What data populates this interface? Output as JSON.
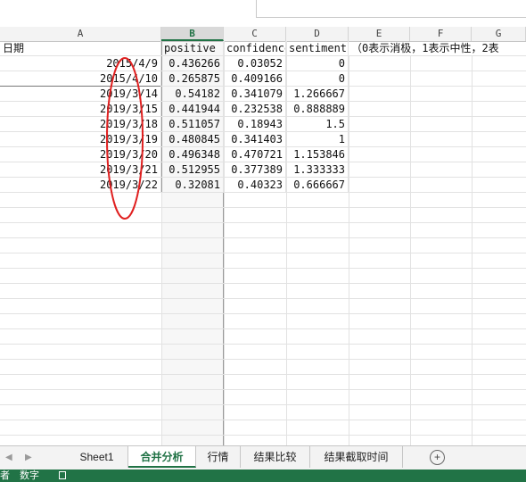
{
  "columns": [
    {
      "id": "A",
      "label": "A"
    },
    {
      "id": "B",
      "label": "B"
    },
    {
      "id": "C",
      "label": "C"
    },
    {
      "id": "D",
      "label": "D"
    },
    {
      "id": "E",
      "label": "E"
    },
    {
      "id": "F",
      "label": "F"
    },
    {
      "id": "G",
      "label": "G"
    }
  ],
  "selected_column": "B",
  "header_row": {
    "A": "日期",
    "B": "positive",
    "C": "confidence",
    "D": "sentiment",
    "E": "（0表示消极，1表示中性，2表"
  },
  "rows": [
    {
      "A": "2015/4/9",
      "B": "0.436266",
      "C": "0.03052",
      "D": "0"
    },
    {
      "A": "2015/4/10",
      "B": "0.265875",
      "C": "0.409166",
      "D": "0"
    },
    {
      "A": "2019/3/14",
      "B": "0.54182",
      "C": "0.341079",
      "D": "1.266667"
    },
    {
      "A": "2019/3/15",
      "B": "0.441944",
      "C": "0.232538",
      "D": "0.888889"
    },
    {
      "A": "2019/3/18",
      "B": "0.511057",
      "C": "0.18943",
      "D": "1.5"
    },
    {
      "A": "2019/3/19",
      "B": "0.480845",
      "C": "0.341403",
      "D": "1"
    },
    {
      "A": "2019/3/20",
      "B": "0.496348",
      "C": "0.470721",
      "D": "1.153846"
    },
    {
      "A": "2019/3/21",
      "B": "0.512955",
      "C": "0.377389",
      "D": "1.333333"
    },
    {
      "A": "2019/3/22",
      "B": "0.32081",
      "C": "0.40323",
      "D": "0.666667"
    }
  ],
  "tabs": [
    {
      "label": "Sheet1",
      "active": false
    },
    {
      "label": "合并分析",
      "active": true
    },
    {
      "label": "行情",
      "active": false
    },
    {
      "label": "结果比较",
      "active": false
    },
    {
      "label": "结果截取时间",
      "active": false
    }
  ],
  "nav_icons": [
    "nav-left-icon",
    "nav-right-icon"
  ],
  "status_bar": {
    "left_text": "者",
    "mode_text": "数字",
    "accent_color": "#217346"
  },
  "annotation": {
    "shape": "red-ellipse",
    "color": "#e02020"
  }
}
